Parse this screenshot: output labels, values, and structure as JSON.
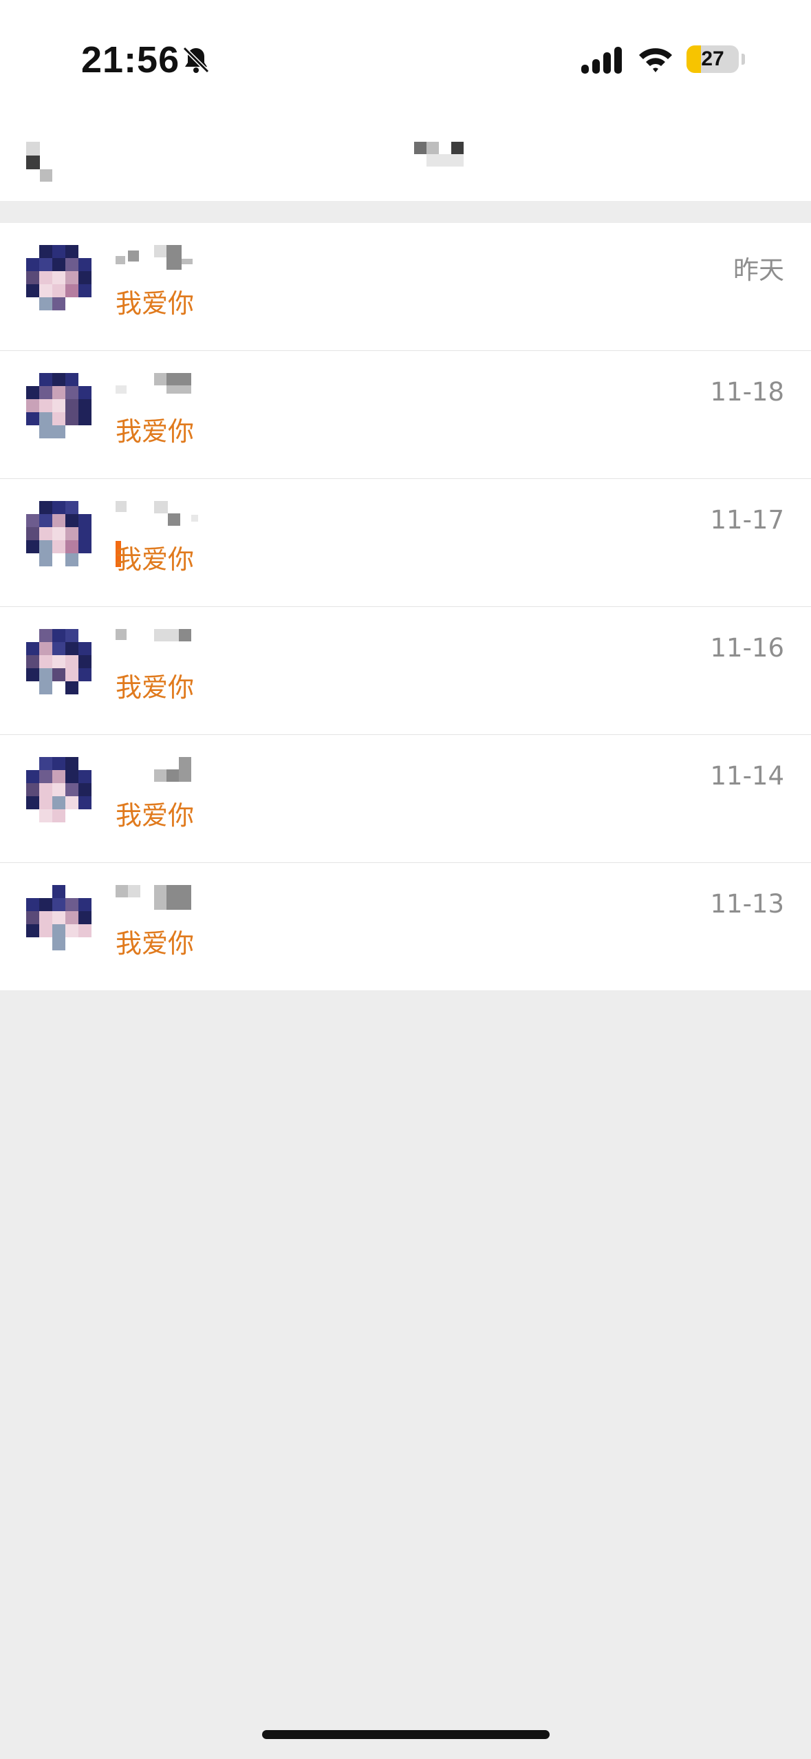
{
  "status_bar": {
    "time": "21:56",
    "battery_level": "27",
    "battery_fraction": 0.27,
    "icons": [
      "bell-slash-icon",
      "signal-icon",
      "wifi-icon",
      "battery-icon"
    ]
  },
  "colors": {
    "message": "#e07a1d",
    "date": "#8e8e8e",
    "background": "#ededed"
  },
  "conversations": [
    {
      "message": "我爱你",
      "date": "昨天"
    },
    {
      "message": "我爱你",
      "date": "11-18"
    },
    {
      "message": "我爱你",
      "date": "11-17"
    },
    {
      "message": "我爱你",
      "date": "11-16"
    },
    {
      "message": "我爱你",
      "date": "11-14"
    },
    {
      "message": "我爱你",
      "date": "11-13"
    }
  ]
}
